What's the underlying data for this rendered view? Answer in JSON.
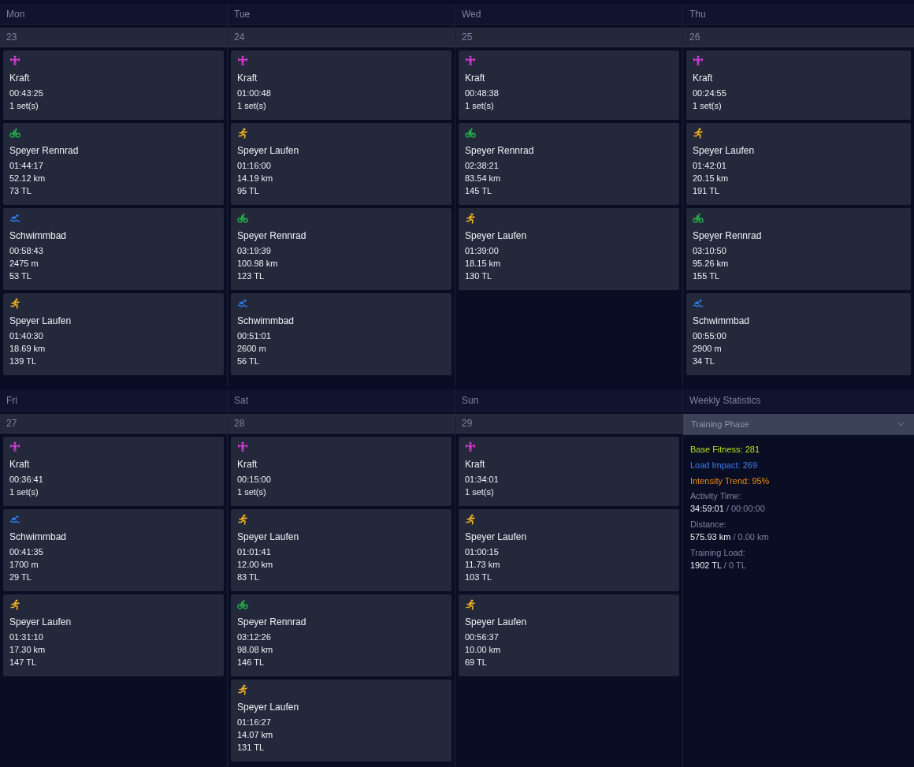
{
  "weeks": [
    {
      "days": [
        {
          "name": "Mon",
          "date": "23",
          "activities": [
            {
              "kind": "strength",
              "title": "Kraft",
              "lines": [
                "00:43:25",
                "1 set(s)"
              ]
            },
            {
              "kind": "bike",
              "title": "Speyer Rennrad",
              "lines": [
                "01:44:17",
                "52.12 km",
                "73 TL"
              ]
            },
            {
              "kind": "swim",
              "title": "Schwimmbad",
              "lines": [
                "00:58:43",
                "2475 m",
                "53 TL"
              ]
            },
            {
              "kind": "run",
              "title": "Speyer Laufen",
              "lines": [
                "01:40:30",
                "18.69 km",
                "139 TL"
              ]
            }
          ]
        },
        {
          "name": "Tue",
          "date": "24",
          "activities": [
            {
              "kind": "strength",
              "title": "Kraft",
              "lines": [
                "01:00:48",
                "1 set(s)"
              ]
            },
            {
              "kind": "run",
              "title": "Speyer Laufen",
              "lines": [
                "01:16:00",
                "14.19 km",
                "95 TL"
              ]
            },
            {
              "kind": "bike",
              "title": "Speyer Rennrad",
              "lines": [
                "03:19:39",
                "100.98 km",
                "123 TL"
              ]
            },
            {
              "kind": "swim",
              "title": "Schwimmbad",
              "lines": [
                "00:51:01",
                "2600 m",
                "56 TL"
              ]
            }
          ]
        },
        {
          "name": "Wed",
          "date": "25",
          "activities": [
            {
              "kind": "strength",
              "title": "Kraft",
              "lines": [
                "00:48:38",
                "1 set(s)"
              ]
            },
            {
              "kind": "bike",
              "title": "Speyer Rennrad",
              "lines": [
                "02:38:21",
                "83.54 km",
                "145 TL"
              ]
            },
            {
              "kind": "run",
              "title": "Speyer Laufen",
              "lines": [
                "01:39:00",
                "18.15 km",
                "130 TL"
              ]
            }
          ]
        },
        {
          "name": "Thu",
          "date": "26",
          "activities": [
            {
              "kind": "strength",
              "title": "Kraft",
              "lines": [
                "00:24:55",
                "1 set(s)"
              ]
            },
            {
              "kind": "run",
              "title": "Speyer Laufen",
              "lines": [
                "01:42:01",
                "20.15 km",
                "191 TL"
              ]
            },
            {
              "kind": "bike",
              "title": "Speyer Rennrad",
              "lines": [
                "03:10:50",
                "95.26 km",
                "155 TL"
              ]
            },
            {
              "kind": "swim",
              "title": "Schwimmbad",
              "lines": [
                "00:55:00",
                "2900 m",
                "34 TL"
              ]
            }
          ]
        }
      ]
    },
    {
      "days": [
        {
          "name": "Fri",
          "date": "27",
          "activities": [
            {
              "kind": "strength",
              "title": "Kraft",
              "lines": [
                "00:36:41",
                "1 set(s)"
              ]
            },
            {
              "kind": "swim",
              "title": "Schwimmbad",
              "lines": [
                "00:41:35",
                "1700 m",
                "29 TL"
              ]
            },
            {
              "kind": "run",
              "title": "Speyer Laufen",
              "lines": [
                "01:31:10",
                "17.30 km",
                "147 TL"
              ]
            }
          ]
        },
        {
          "name": "Sat",
          "date": "28",
          "activities": [
            {
              "kind": "strength",
              "title": "Kraft",
              "lines": [
                "00:15:00",
                "1 set(s)"
              ]
            },
            {
              "kind": "run",
              "title": "Speyer Laufen",
              "lines": [
                "01:01:41",
                "12.00 km",
                "83 TL"
              ]
            },
            {
              "kind": "bike",
              "title": "Speyer Rennrad",
              "lines": [
                "03:12:26",
                "98.08 km",
                "146 TL"
              ]
            },
            {
              "kind": "run",
              "title": "Speyer Laufen",
              "lines": [
                "01:16:27",
                "14.07 km",
                "131 TL"
              ]
            }
          ]
        },
        {
          "name": "Sun",
          "date": "29",
          "activities": [
            {
              "kind": "strength",
              "title": "Kraft",
              "lines": [
                "01:34:01",
                "1 set(s)"
              ]
            },
            {
              "kind": "run",
              "title": "Speyer Laufen",
              "lines": [
                "01:00:15",
                "11.73 km",
                "103 TL"
              ]
            },
            {
              "kind": "run",
              "title": "Speyer Laufen",
              "lines": [
                "00:56:37",
                "10.00 km",
                "69 TL"
              ]
            }
          ]
        }
      ]
    }
  ],
  "statistics": {
    "title": "Weekly Statistics",
    "phase_dropdown": "Training Phase",
    "metrics": [
      {
        "text": "Base Fitness: 281",
        "color": "#b4e61e"
      },
      {
        "text": "Load Impact: 269",
        "color": "#3a7cf2"
      },
      {
        "text": "Intensity Trend: 95%",
        "color": "#f0890f"
      }
    ],
    "totals": [
      {
        "label": "Activity Time:",
        "value": "34:59:01",
        "target": "/ 00:00:00"
      },
      {
        "label": "Distance:",
        "value": "575.93 km",
        "target": "/ 0.00 km"
      },
      {
        "label": "Training Load:",
        "value": "1902 TL",
        "target": "/ 0 TL"
      }
    ]
  }
}
